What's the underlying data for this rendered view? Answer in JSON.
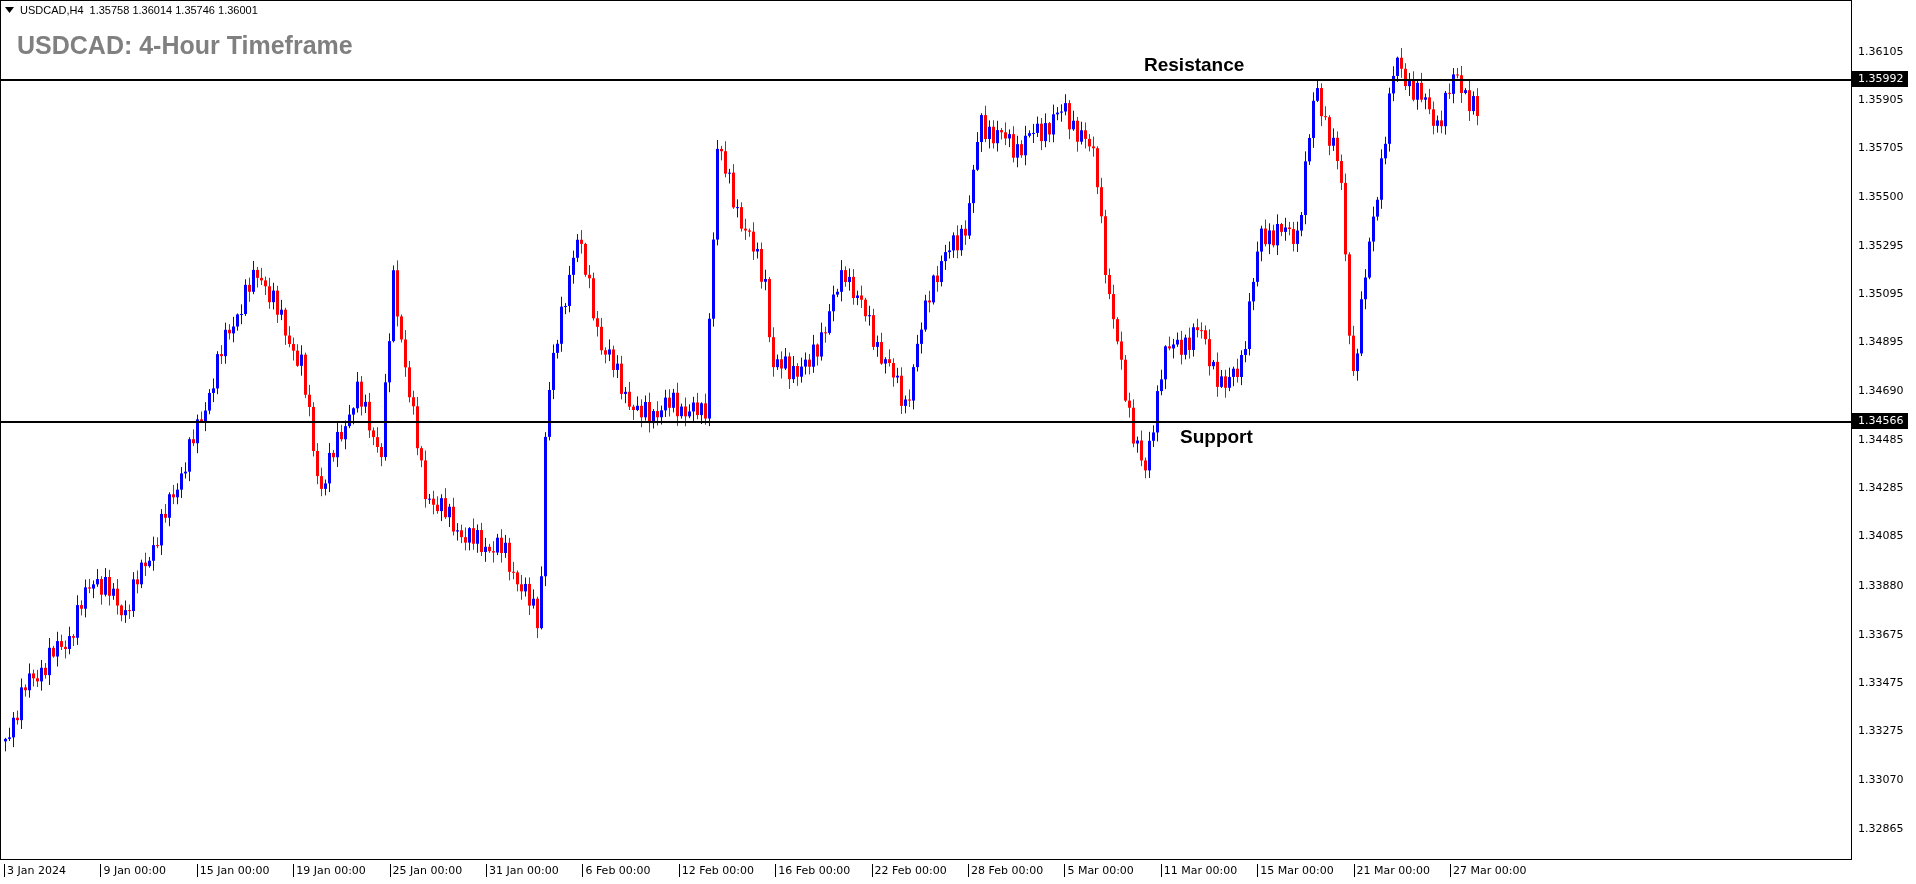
{
  "header": {
    "symbol": "USDCAD,H4",
    "ohlc": "1.35758 1.36014 1.35746 1.36001"
  },
  "title": "USDCAD: 4-Hour Timeframe",
  "levels": [
    {
      "label": "Resistance",
      "price": "1.35992"
    },
    {
      "label": "Support",
      "price": "1.34566"
    }
  ],
  "price_axis": [
    "1.36105",
    "1.35905",
    "1.35705",
    "1.35500",
    "1.35295",
    "1.35095",
    "1.34895",
    "1.34690",
    "1.34485",
    "1.34285",
    "1.34085",
    "1.33880",
    "1.33675",
    "1.33475",
    "1.33275",
    "1.33070",
    "1.32865"
  ],
  "time_axis": [
    "3 Jan 2024",
    "9 Jan 00:00",
    "15 Jan 00:00",
    "19 Jan 00:00",
    "25 Jan 00:00",
    "31 Jan 00:00",
    "6 Feb 00:00",
    "12 Feb 00:00",
    "16 Feb 00:00",
    "22 Feb 00:00",
    "28 Feb 00:00",
    "5 Mar 00:00",
    "11 Mar 00:00",
    "15 Mar 00:00",
    "21 Mar 00:00",
    "27 Mar 00:00"
  ]
}
